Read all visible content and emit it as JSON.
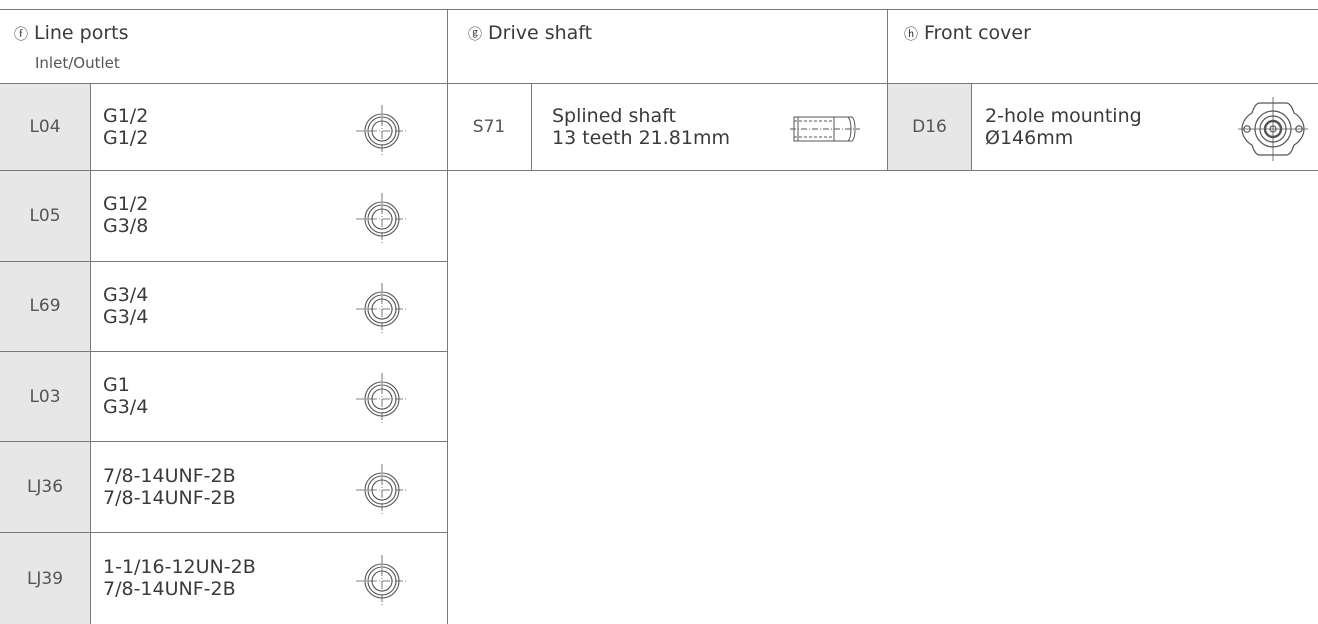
{
  "sections": {
    "line_ports": {
      "letter": "ⓕ",
      "title": "Line ports",
      "subtitle": "Inlet/Outlet"
    },
    "drive_shaft": {
      "letter": "ⓖ",
      "title": "Drive shaft"
    },
    "front_cover": {
      "letter": "ⓗ",
      "title": "Front cover"
    }
  },
  "line_ports_rows": [
    {
      "code": "L04",
      "line1": "G1/2",
      "line2": "G1/2",
      "icon": "port-symbol-icon"
    },
    {
      "code": "L05",
      "line1": "G1/2",
      "line2": "G3/8",
      "icon": "port-symbol-icon"
    },
    {
      "code": "L69",
      "line1": "G3/4",
      "line2": "G3/4",
      "icon": "port-symbol-icon"
    },
    {
      "code": "L03",
      "line1": "G1",
      "line2": "G3/4",
      "icon": "port-symbol-icon"
    },
    {
      "code": "LJ36",
      "line1": "7/8-14UNF-2B",
      "line2": "7/8-14UNF-2B",
      "icon": "port-symbol-icon"
    },
    {
      "code": "LJ39",
      "line1": "1-1/16-12UN-2B",
      "line2": "7/8-14UNF-2B",
      "icon": "port-symbol-icon"
    }
  ],
  "drive_shaft_row": {
    "code": "S71",
    "line1": "Splined shaft",
    "line2": "13 teeth 21.81mm",
    "icon": "splined-shaft-icon"
  },
  "front_cover_row": {
    "code": "D16",
    "line1": "2-hole mounting",
    "line2": "Ø146mm",
    "icon": "mounting-flange-icon"
  },
  "colors": {
    "code_cell_bg": "#e7e7e7",
    "rule": "#7a7a7a",
    "text": "#3a3a3a"
  }
}
